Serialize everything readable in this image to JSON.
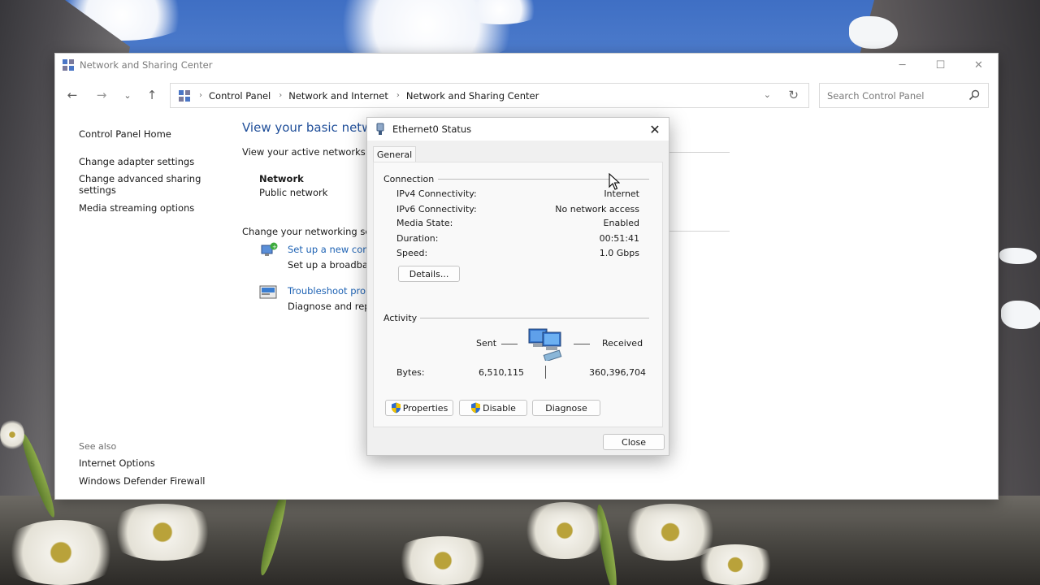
{
  "window": {
    "title": "Network and Sharing Center",
    "controls": {
      "minimize": "─",
      "maximize": "☐",
      "close": "✕"
    }
  },
  "nav": {
    "back": "←",
    "forward": "→",
    "recent": "⌄",
    "up": "↑"
  },
  "breadcrumb": [
    "Control Panel",
    "Network and Internet",
    "Network and Sharing Center"
  ],
  "search": {
    "placeholder": "Search Control Panel"
  },
  "sidebar": {
    "items": [
      {
        "label": "Control Panel Home"
      },
      {
        "label": "Change adapter settings"
      },
      {
        "label": "Change advanced sharing settings"
      },
      {
        "label": "Media streaming options"
      }
    ],
    "see_also": "See also",
    "see_also_items": [
      {
        "label": "Internet Options"
      },
      {
        "label": "Windows Defender Firewall"
      }
    ]
  },
  "main": {
    "title": "View your basic netw",
    "active_networks_label": "View your active networks",
    "network_name": "Network",
    "network_type": "Public network",
    "change_settings_label": "Change your networking set",
    "tasks": [
      {
        "link": "Set up a new conn",
        "desc": "Set up a broadban"
      },
      {
        "link": "Troubleshoot prob",
        "desc": "Diagnose and repa"
      }
    ]
  },
  "dialog": {
    "title": "Ethernet0 Status",
    "tab": "General",
    "connection_label": "Connection",
    "connection": [
      {
        "key": "IPv4 Connectivity:",
        "value": "Internet"
      },
      {
        "key": "IPv6 Connectivity:",
        "value": "No network access"
      },
      {
        "key": "Media State:",
        "value": "Enabled"
      },
      {
        "key": "Duration:",
        "value": "00:51:41"
      },
      {
        "key": "Speed:",
        "value": "1.0 Gbps"
      }
    ],
    "details_button": "Details...",
    "activity_label": "Activity",
    "sent_label": "Sent",
    "received_label": "Received",
    "bytes_label": "Bytes:",
    "bytes_sent": "6,510,115",
    "bytes_received": "360,396,704",
    "properties_button": "Properties",
    "disable_button": "Disable",
    "diagnose_button": "Diagnose",
    "close_button": "Close",
    "close_icon": "✕"
  },
  "colors": {
    "link": "#1f63b4",
    "title_blue": "#1f4e99",
    "dialog_bg": "#f0f0f0"
  }
}
